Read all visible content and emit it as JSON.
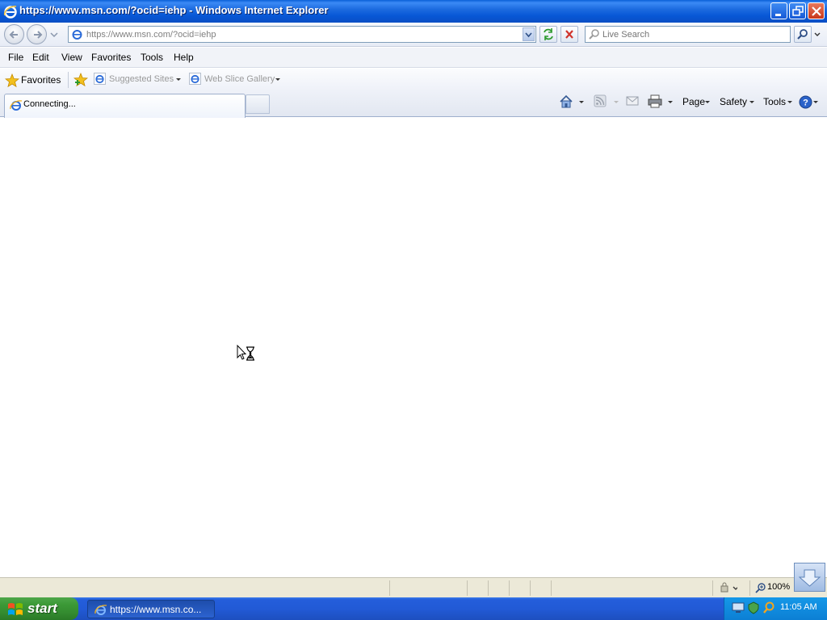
{
  "window": {
    "title": "https://www.msn.com/?ocid=iehp - Windows Internet Explorer"
  },
  "address": {
    "url": "https://www.msn.com/?ocid=iehp"
  },
  "search": {
    "placeholder": "Live Search"
  },
  "menu": {
    "items": [
      "File",
      "Edit",
      "View",
      "Favorites",
      "Tools",
      "Help"
    ]
  },
  "favorites_bar": {
    "favorites_label": "Favorites",
    "links": [
      "Suggested Sites",
      "Web Slice Gallery"
    ]
  },
  "tab": {
    "label": "Connecting..."
  },
  "command_bar": {
    "page_label": "Page",
    "safety_label": "Safety",
    "tools_label": "Tools"
  },
  "status_bar": {
    "zoom": "100%"
  },
  "taskbar": {
    "start_label": "start",
    "task_label": "https://www.msn.co...",
    "clock": "11:05 AM"
  },
  "colors": {
    "titlebar": "#0757d6",
    "taskbar": "#245edb",
    "start_button": "#3c9a37",
    "tray": "#0c7fd4"
  },
  "icons": [
    "ie-icon",
    "minimize-icon",
    "restore-icon",
    "close-icon",
    "back-icon",
    "forward-icon",
    "refresh-icon",
    "stop-icon",
    "search-icon",
    "favorites-star-icon",
    "add-favorites-icon",
    "home-icon",
    "feeds-icon",
    "mail-icon",
    "print-icon",
    "help-icon",
    "zoom-icon",
    "hourglass-cursor-icon",
    "windows-flag-icon"
  ]
}
